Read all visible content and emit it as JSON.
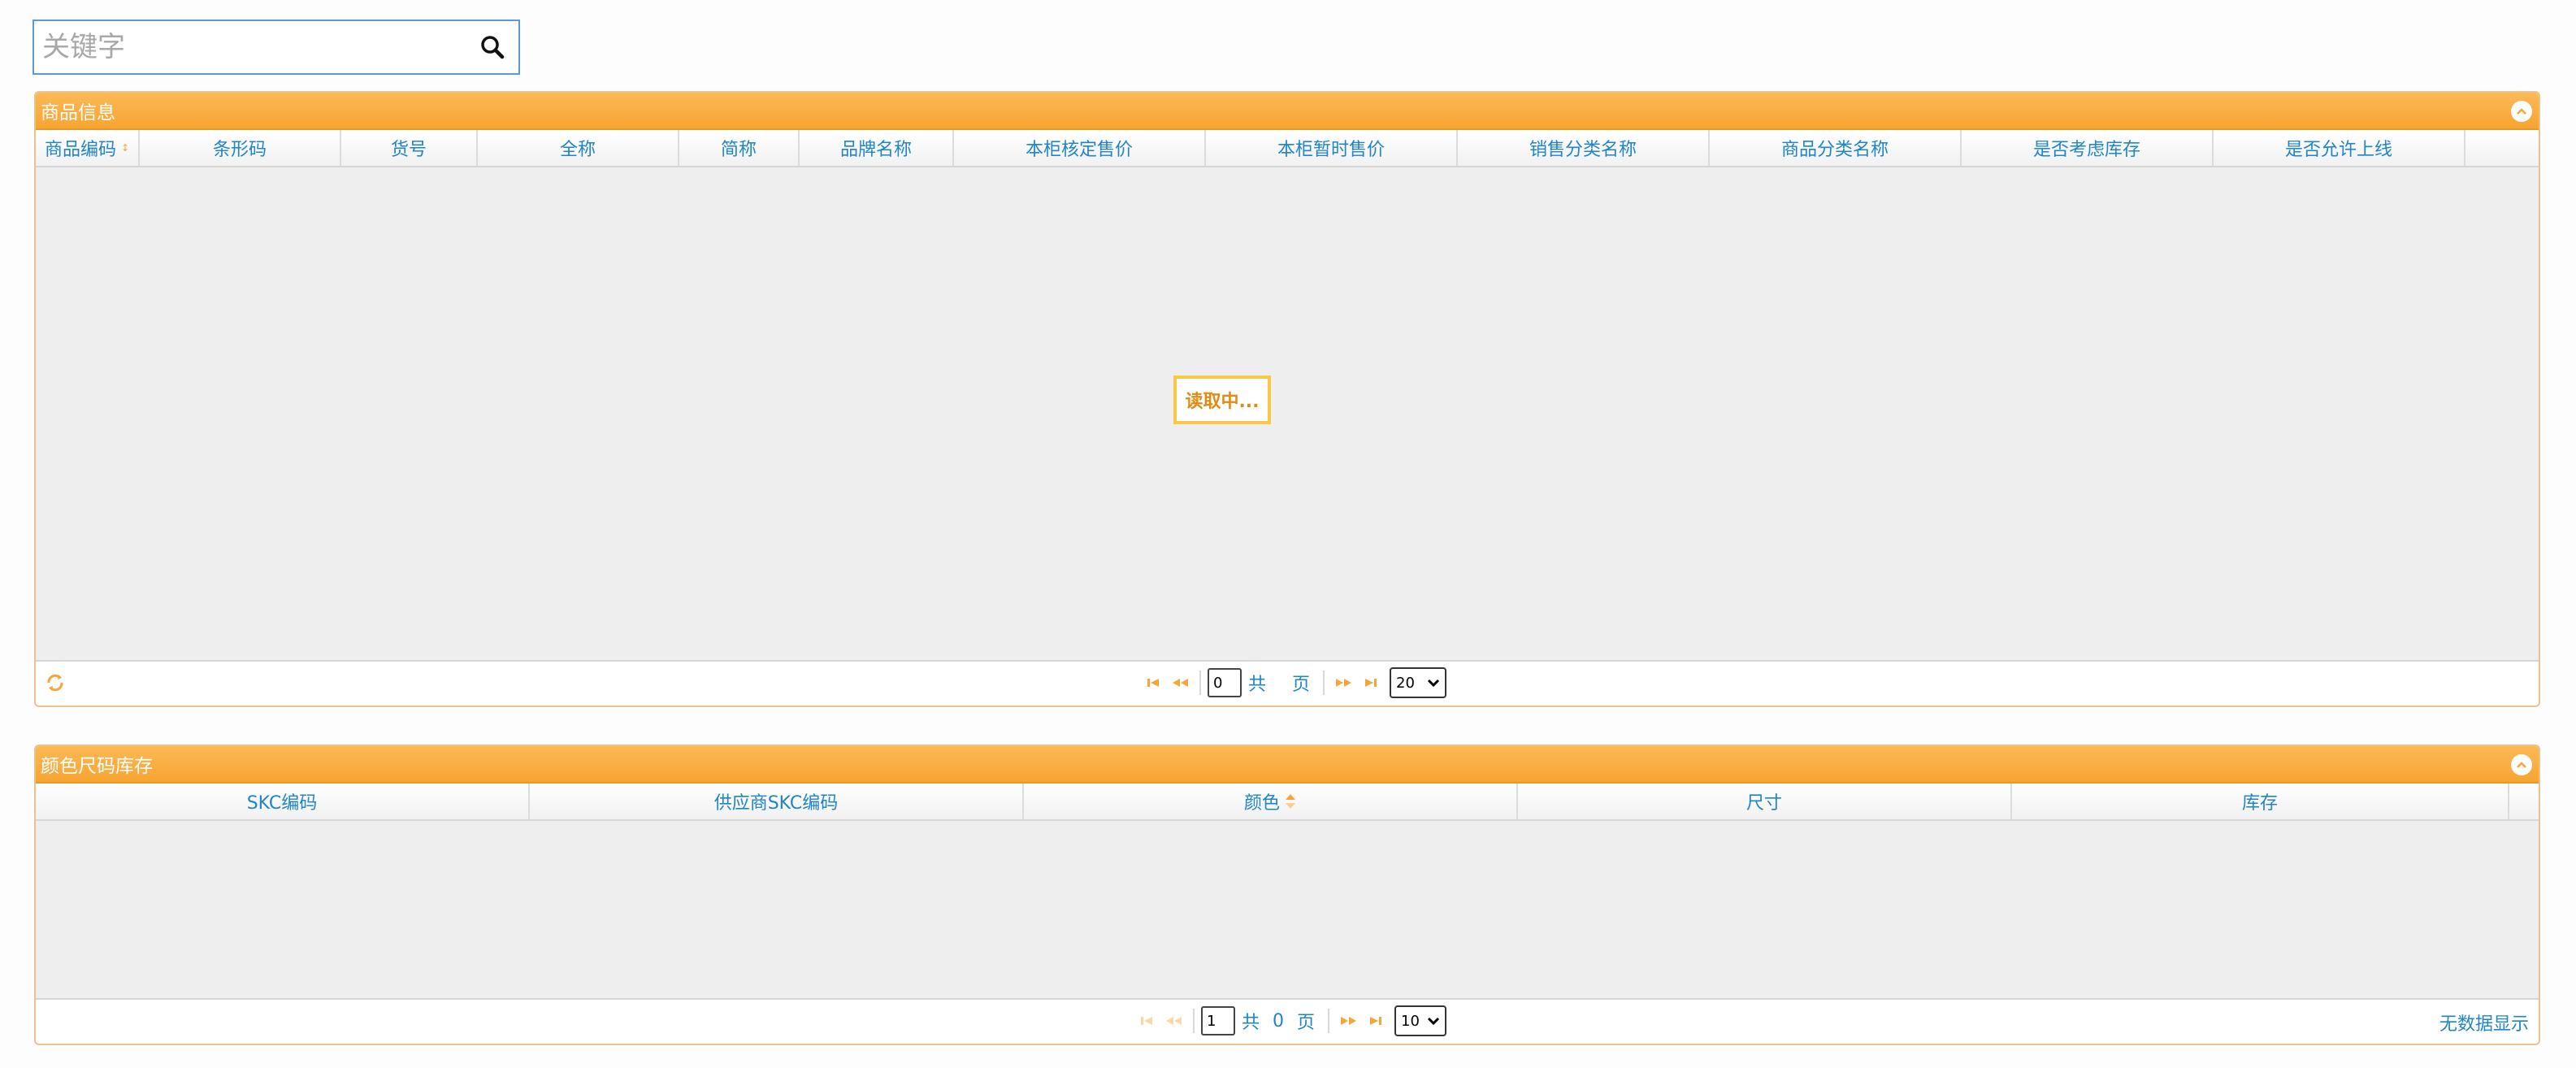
{
  "search": {
    "placeholder": "关键字"
  },
  "product_panel": {
    "title": "商品信息",
    "columns": [
      {
        "label": "商品编码",
        "sorted": true
      },
      {
        "label": "条形码"
      },
      {
        "label": "货号"
      },
      {
        "label": "全称"
      },
      {
        "label": "简称"
      },
      {
        "label": "品牌名称"
      },
      {
        "label": "本柜核定售价"
      },
      {
        "label": "本柜暂时售价"
      },
      {
        "label": "销售分类名称"
      },
      {
        "label": "商品分类名称"
      },
      {
        "label": "是否考虑库存"
      },
      {
        "label": "是否允许上线"
      }
    ],
    "loading_text": "读取中...",
    "pager": {
      "page": "0",
      "total_prefix": "共",
      "total_value": "",
      "total_suffix": "页",
      "page_size": "20"
    }
  },
  "stock_panel": {
    "title": "颜色尺码库存",
    "columns": [
      {
        "label": "SKC编码"
      },
      {
        "label": "供应商SKC编码"
      },
      {
        "label": "颜色",
        "sorted": true
      },
      {
        "label": "尺寸"
      },
      {
        "label": "库存"
      }
    ],
    "pager": {
      "page": "1",
      "total_prefix": "共",
      "total_value": "0",
      "total_suffix": "页",
      "page_size": "10"
    },
    "no_data_text": "无数据显示"
  },
  "colors": {
    "accent": "#f8a430",
    "link": "#1f85c4",
    "loading": "#e28b13"
  }
}
